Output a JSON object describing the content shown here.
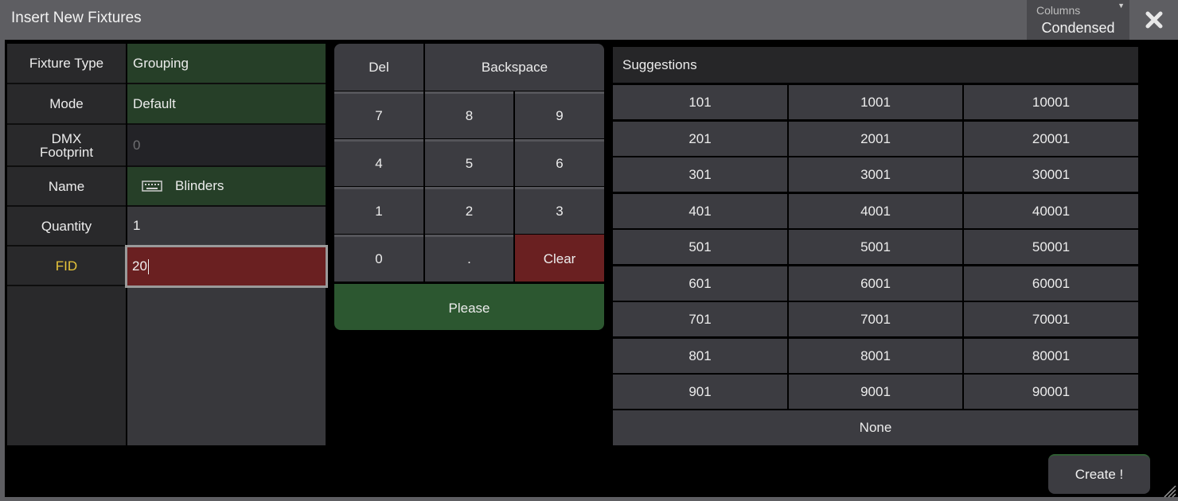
{
  "window": {
    "title": "Insert New Fixtures"
  },
  "columns": {
    "label": "Columns",
    "value": "Condensed"
  },
  "fields": [
    {
      "label": "Fixture Type",
      "value": "Grouping"
    },
    {
      "label": "Mode",
      "value": "Default"
    },
    {
      "label_line1": "DMX",
      "label_line2": "Footprint",
      "value": "0"
    },
    {
      "label": "Name",
      "value": "Blinders",
      "icon": "keyboard-icon"
    },
    {
      "label": "Quantity",
      "value": "1"
    },
    {
      "label": "FID",
      "value": "20"
    }
  ],
  "keypad": {
    "del": "Del",
    "backspace": "Backspace",
    "k7": "7",
    "k8": "8",
    "k9": "9",
    "k4": "4",
    "k5": "5",
    "k6": "6",
    "k1": "1",
    "k2": "2",
    "k3": "3",
    "k0": "0",
    "dot": ".",
    "clear": "Clear",
    "please": "Please"
  },
  "suggestions": {
    "header": "Suggestions",
    "rows": [
      [
        "101",
        "1001",
        "10001"
      ],
      [
        "201",
        "2001",
        "20001"
      ],
      [
        "301",
        "3001",
        "30001"
      ],
      [
        "401",
        "4001",
        "40001"
      ],
      [
        "501",
        "5001",
        "50001"
      ],
      [
        "601",
        "6001",
        "60001"
      ],
      [
        "701",
        "7001",
        "70001"
      ],
      [
        "801",
        "8001",
        "80001"
      ],
      [
        "901",
        "9001",
        "90001"
      ]
    ],
    "none": "None"
  },
  "actions": {
    "create": "Create !"
  },
  "colors": {
    "green_field": "#263f28",
    "red_active": "#6a2021",
    "please_green": "#2c5730",
    "fid_label": "#e8c53a"
  }
}
